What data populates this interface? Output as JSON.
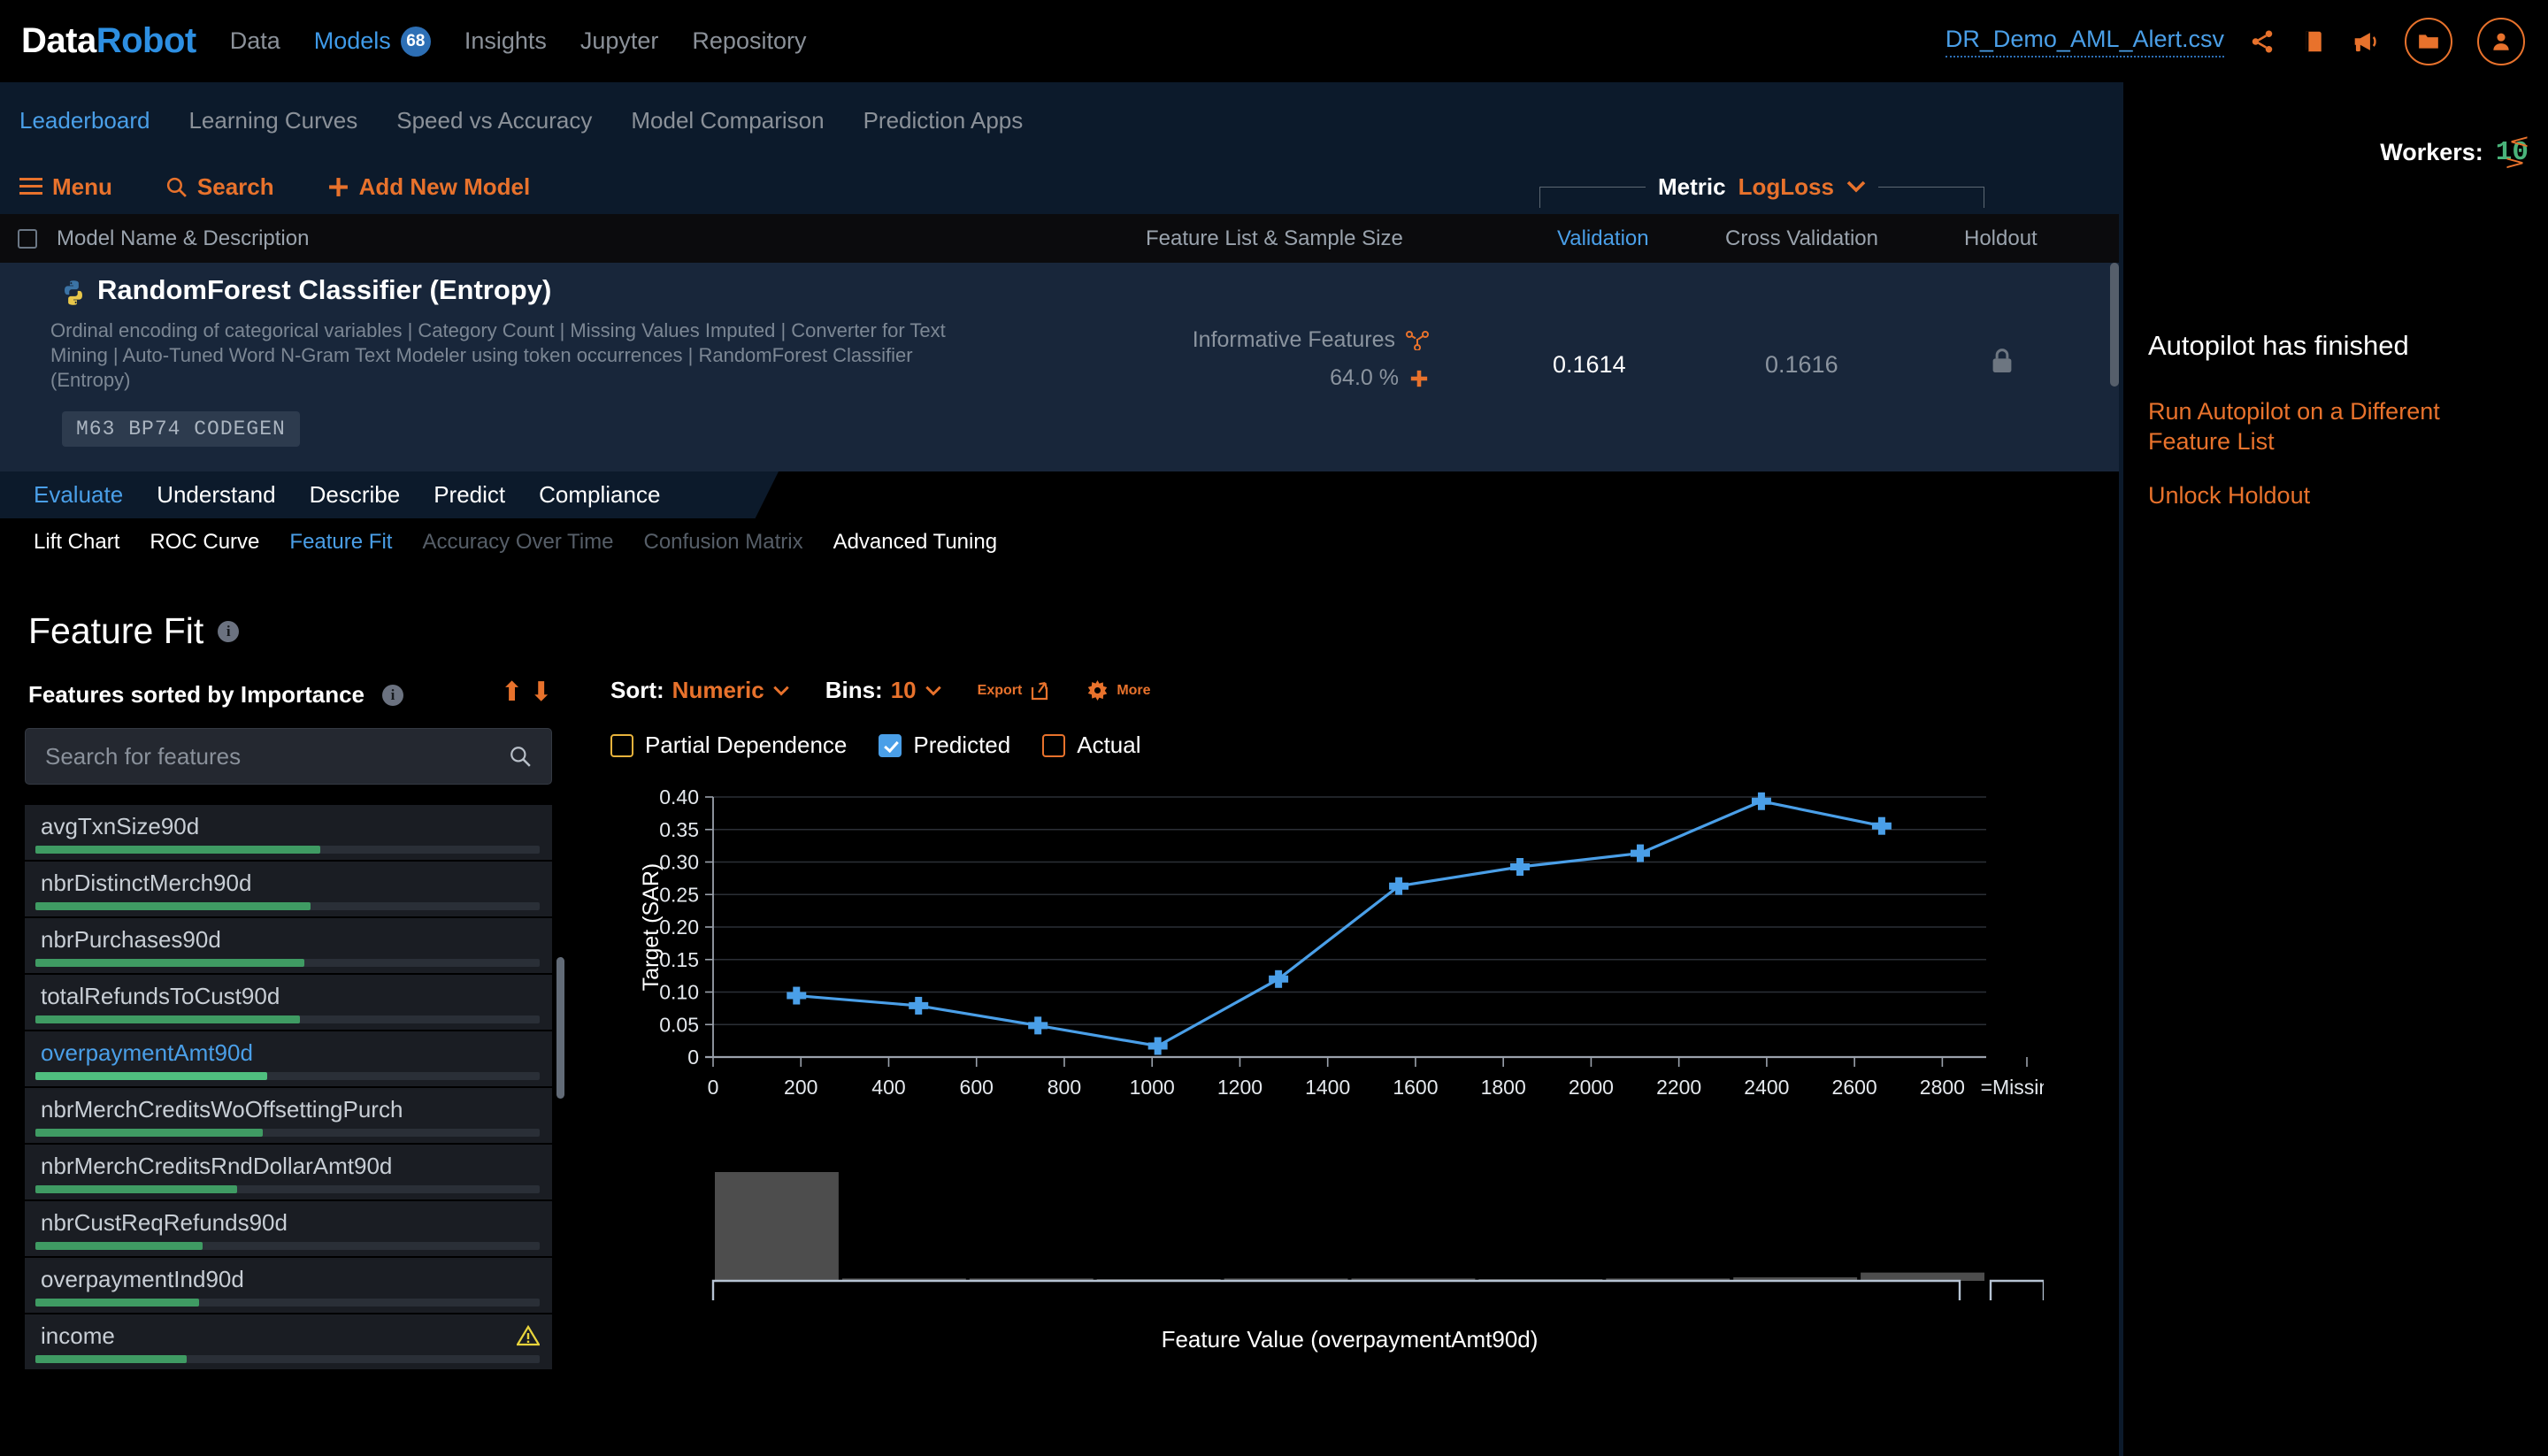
{
  "topnav": {
    "logo_part1": "Data",
    "logo_part2": "Robot",
    "links": [
      {
        "label": "Data",
        "active": false
      },
      {
        "label": "Models",
        "active": true,
        "badge": "68"
      },
      {
        "label": "Insights",
        "active": false
      },
      {
        "label": "Jupyter",
        "active": false
      },
      {
        "label": "Repository",
        "active": false
      }
    ],
    "dataset_name": "DR_Demo_AML_Alert.csv",
    "icons": [
      "share-icon",
      "book-icon",
      "megaphone-icon",
      "folder-icon",
      "user-avatar-icon"
    ]
  },
  "subnav": {
    "links": [
      {
        "label": "Leaderboard",
        "active": true
      },
      {
        "label": "Learning Curves",
        "active": false
      },
      {
        "label": "Speed vs Accuracy",
        "active": false
      },
      {
        "label": "Model Comparison",
        "active": false
      },
      {
        "label": "Prediction Apps",
        "active": false
      }
    ]
  },
  "toolbar": {
    "menu_label": "Menu",
    "search_label": "Search",
    "add_model_label": "Add New Model",
    "metric_label": "Metric",
    "metric_value": "LogLoss"
  },
  "table_header": {
    "model_name": "Model Name & Description",
    "feature_list": "Feature List & Sample Size",
    "validation": "Validation",
    "cross_validation": "Cross Validation",
    "holdout": "Holdout"
  },
  "model_row": {
    "title": "RandomForest Classifier (Entropy)",
    "description": "Ordinal encoding of categorical variables | Category Count | Missing Values Imputed | Converter for Text Mining | Auto-Tuned Word N-Gram Text Modeler using token occurrences | RandomForest Classifier (Entropy)",
    "tags": "M63  BP74  CODEGEN",
    "feature_list_name": "Informative Features",
    "sample_size": "64.0 %",
    "validation_score": "0.1614",
    "cross_validation_score": "0.1616",
    "holdout_locked": "lock-icon"
  },
  "model_tabs": [
    {
      "label": "Evaluate",
      "active": true
    },
    {
      "label": "Understand",
      "active": false
    },
    {
      "label": "Describe",
      "active": false
    },
    {
      "label": "Predict",
      "active": false
    },
    {
      "label": "Compliance",
      "active": false
    }
  ],
  "sub_tabs": [
    {
      "label": "Lift Chart",
      "active": false,
      "disabled": false
    },
    {
      "label": "ROC Curve",
      "active": false,
      "disabled": false
    },
    {
      "label": "Feature Fit",
      "active": true,
      "disabled": false
    },
    {
      "label": "Accuracy Over Time",
      "active": false,
      "disabled": true
    },
    {
      "label": "Confusion Matrix",
      "active": false,
      "disabled": true
    },
    {
      "label": "Advanced Tuning",
      "active": false,
      "disabled": false
    }
  ],
  "feature_fit": {
    "title": "Feature Fit",
    "sorted_label": "Features sorted by Importance",
    "search_placeholder": "Search for features",
    "search_value": "",
    "sort_label": "Sort:",
    "sort_value": "Numeric",
    "bins_label": "Bins:",
    "bins_value": "10",
    "export_label": "Export",
    "more_label": "More",
    "checkboxes": [
      {
        "label": "Partial Dependence",
        "checked": false,
        "color": "#e8b33c"
      },
      {
        "label": "Predicted",
        "checked": true,
        "color": "#4a9fe8"
      },
      {
        "label": "Actual",
        "checked": false,
        "color": "#e8722c"
      }
    ]
  },
  "features": [
    {
      "name": "avgTxnSize90d",
      "importance": 0.565,
      "selected": false,
      "warning": false
    },
    {
      "name": "nbrDistinctMerch90d",
      "importance": 0.545,
      "selected": false,
      "warning": false
    },
    {
      "name": "nbrPurchases90d",
      "importance": 0.533,
      "selected": false,
      "warning": false
    },
    {
      "name": "totalRefundsToCust90d",
      "importance": 0.525,
      "selected": false,
      "warning": false
    },
    {
      "name": "overpaymentAmt90d",
      "importance": 0.46,
      "selected": true,
      "warning": false
    },
    {
      "name": "nbrMerchCreditsWoOffsettingPurch",
      "importance": 0.45,
      "selected": false,
      "warning": false
    },
    {
      "name": "nbrMerchCreditsRndDollarAmt90d",
      "importance": 0.4,
      "selected": false,
      "warning": false
    },
    {
      "name": "nbrCustReqRefunds90d",
      "importance": 0.332,
      "selected": false,
      "warning": false
    },
    {
      "name": "overpaymentInd90d",
      "importance": 0.325,
      "selected": false,
      "warning": false
    },
    {
      "name": "income",
      "importance": 0.3,
      "selected": false,
      "warning": true
    }
  ],
  "right_panel": {
    "workers_label": "Workers:",
    "workers_value": "10",
    "autopilot_status": "Autopilot has finished",
    "link_run_autopilot": "Run Autopilot on a Different Feature List",
    "link_unlock_holdout": "Unlock Holdout"
  },
  "chart_data": {
    "type": "line",
    "title": "",
    "xlabel": "Feature Value (overpaymentAmt90d)",
    "ylabel": "Target (SAR)",
    "xlim": [
      0,
      2900
    ],
    "ylim": [
      0,
      0.4
    ],
    "grid": true,
    "ytick_labels": [
      "0",
      "0.05",
      "0.10",
      "0.15",
      "0.20",
      "0.25",
      "0.30",
      "0.35",
      "0.40"
    ],
    "ytick_values": [
      0,
      0.05,
      0.1,
      0.15,
      0.2,
      0.25,
      0.3,
      0.35,
      0.4
    ],
    "xtick_labels": [
      "0",
      "200",
      "400",
      "600",
      "800",
      "1000",
      "1200",
      "1400",
      "1600",
      "1800",
      "2000",
      "2200",
      "2400",
      "2600",
      "2800",
      "=Missing="
    ],
    "xtick_values": [
      0,
      200,
      400,
      600,
      800,
      1000,
      1200,
      1400,
      1600,
      1800,
      2000,
      2200,
      2400,
      2600,
      2800
    ],
    "legend": [
      "Predicted"
    ],
    "series": [
      {
        "name": "Predicted",
        "color": "#4a9fe8",
        "x": [
          190,
          468,
          740,
          1013,
          1288,
          1562,
          1838,
          2112,
          2388,
          2662
        ],
        "y": [
          0.0945,
          0.079,
          0.0485,
          0.017,
          0.12,
          0.263,
          0.2925,
          0.3135,
          0.3935,
          0.3555
        ],
        "yerr_low": [
          0.0865,
          0.0715,
          0.0405,
          0.009,
          0.112,
          0.2555,
          0.2845,
          0.305,
          0.3855,
          0.3475
        ],
        "yerr_high": [
          0.1025,
          0.0865,
          0.0565,
          0.025,
          0.128,
          0.2705,
          0.3005,
          0.3215,
          0.4015,
          0.3635
        ]
      }
    ],
    "histogram": {
      "bin_centers": [
        190,
        468,
        740,
        1013,
        1288,
        1562,
        1838,
        2112,
        2388,
        2662
      ],
      "counts": [
        0.92,
        0.02,
        0.02,
        0.0,
        0.02,
        0.02,
        0.0,
        0.02,
        0.03,
        0.07
      ]
    }
  }
}
